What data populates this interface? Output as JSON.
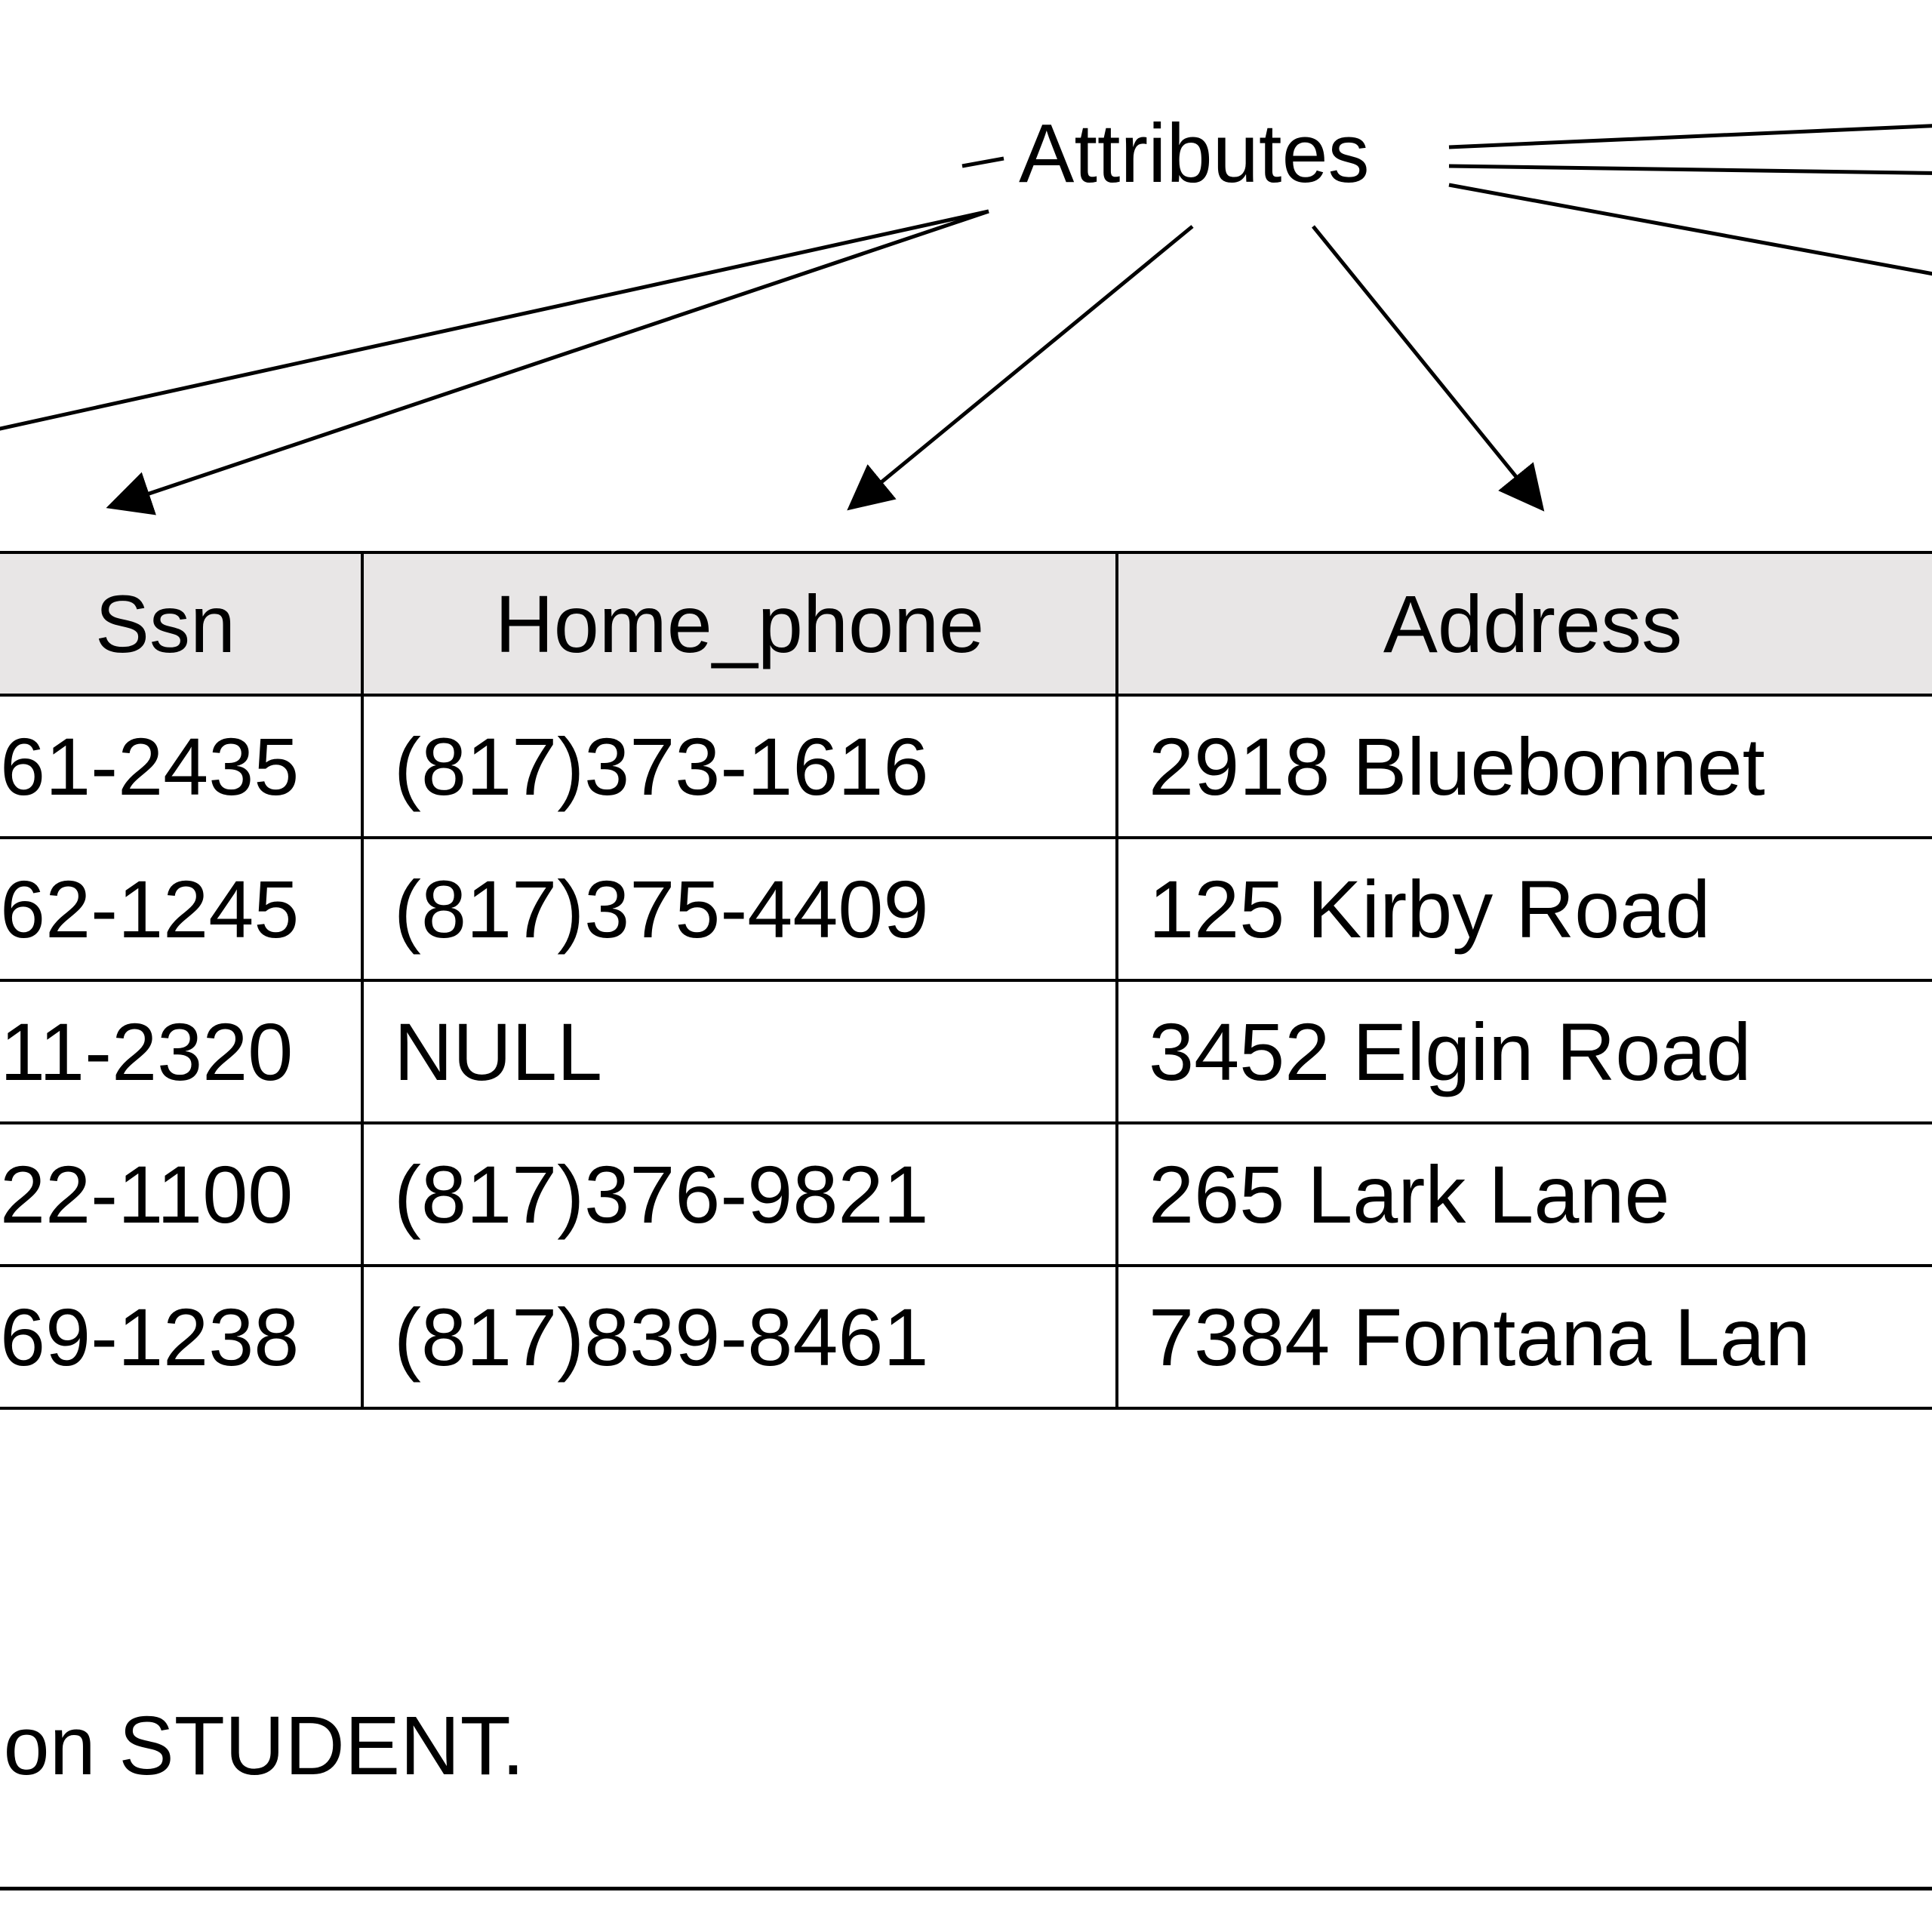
{
  "label": "Attributes",
  "caption": "ion STUDENT.",
  "table": {
    "headers": [
      "Ssn",
      "Home_phone",
      "Address"
    ],
    "rows": [
      {
        "ssn": "61-2435",
        "phone": "(817)373-1616",
        "address": "2918 Bluebonnet"
      },
      {
        "ssn": "62-1245",
        "phone": "(817)375-4409",
        "address": "125 Kirby Road"
      },
      {
        "ssn": "11-2320",
        "phone": "NULL",
        "address": "3452 Elgin Road"
      },
      {
        "ssn": "22-1100",
        "phone": "(817)376-9821",
        "address": "265 Lark Lane"
      },
      {
        "ssn": "69-1238",
        "phone": "(817)839-8461",
        "address": "7384 Fontana Lan"
      }
    ]
  }
}
